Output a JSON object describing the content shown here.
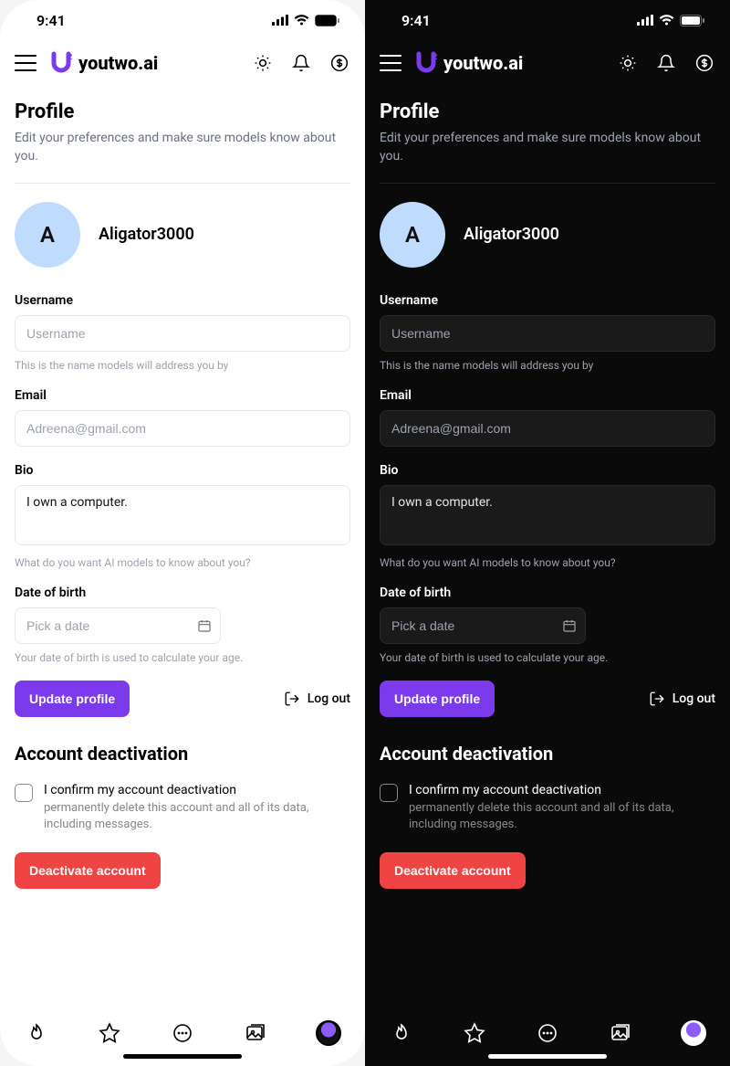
{
  "status": {
    "time": "9:41"
  },
  "brand": {
    "name": "youtwo.ai"
  },
  "page": {
    "title": "Profile",
    "subtitle": "Edit your preferences and make sure models know about you."
  },
  "user": {
    "avatar_initial": "A",
    "display_name": "Aligator3000"
  },
  "fields": {
    "username": {
      "label": "Username",
      "placeholder": "Username",
      "hint": "This is the name models will address you by"
    },
    "email": {
      "label": "Email",
      "placeholder": "Adreena@gmail.com"
    },
    "bio": {
      "label": "Bio",
      "value": "I own a computer.",
      "hint": "What do you want AI models to know about you?"
    },
    "dob": {
      "label": "Date of birth",
      "placeholder": "Pick a date",
      "hint": "Your date of birth is used to calculate your age."
    }
  },
  "actions": {
    "update": "Update profile",
    "logout": "Log out"
  },
  "deactivation": {
    "title": "Account deactivation",
    "confirm_label": "I confirm my account deactivation",
    "confirm_sub": "permanently delete this account and all of its data, including messages.",
    "button": "Deactivate account"
  }
}
